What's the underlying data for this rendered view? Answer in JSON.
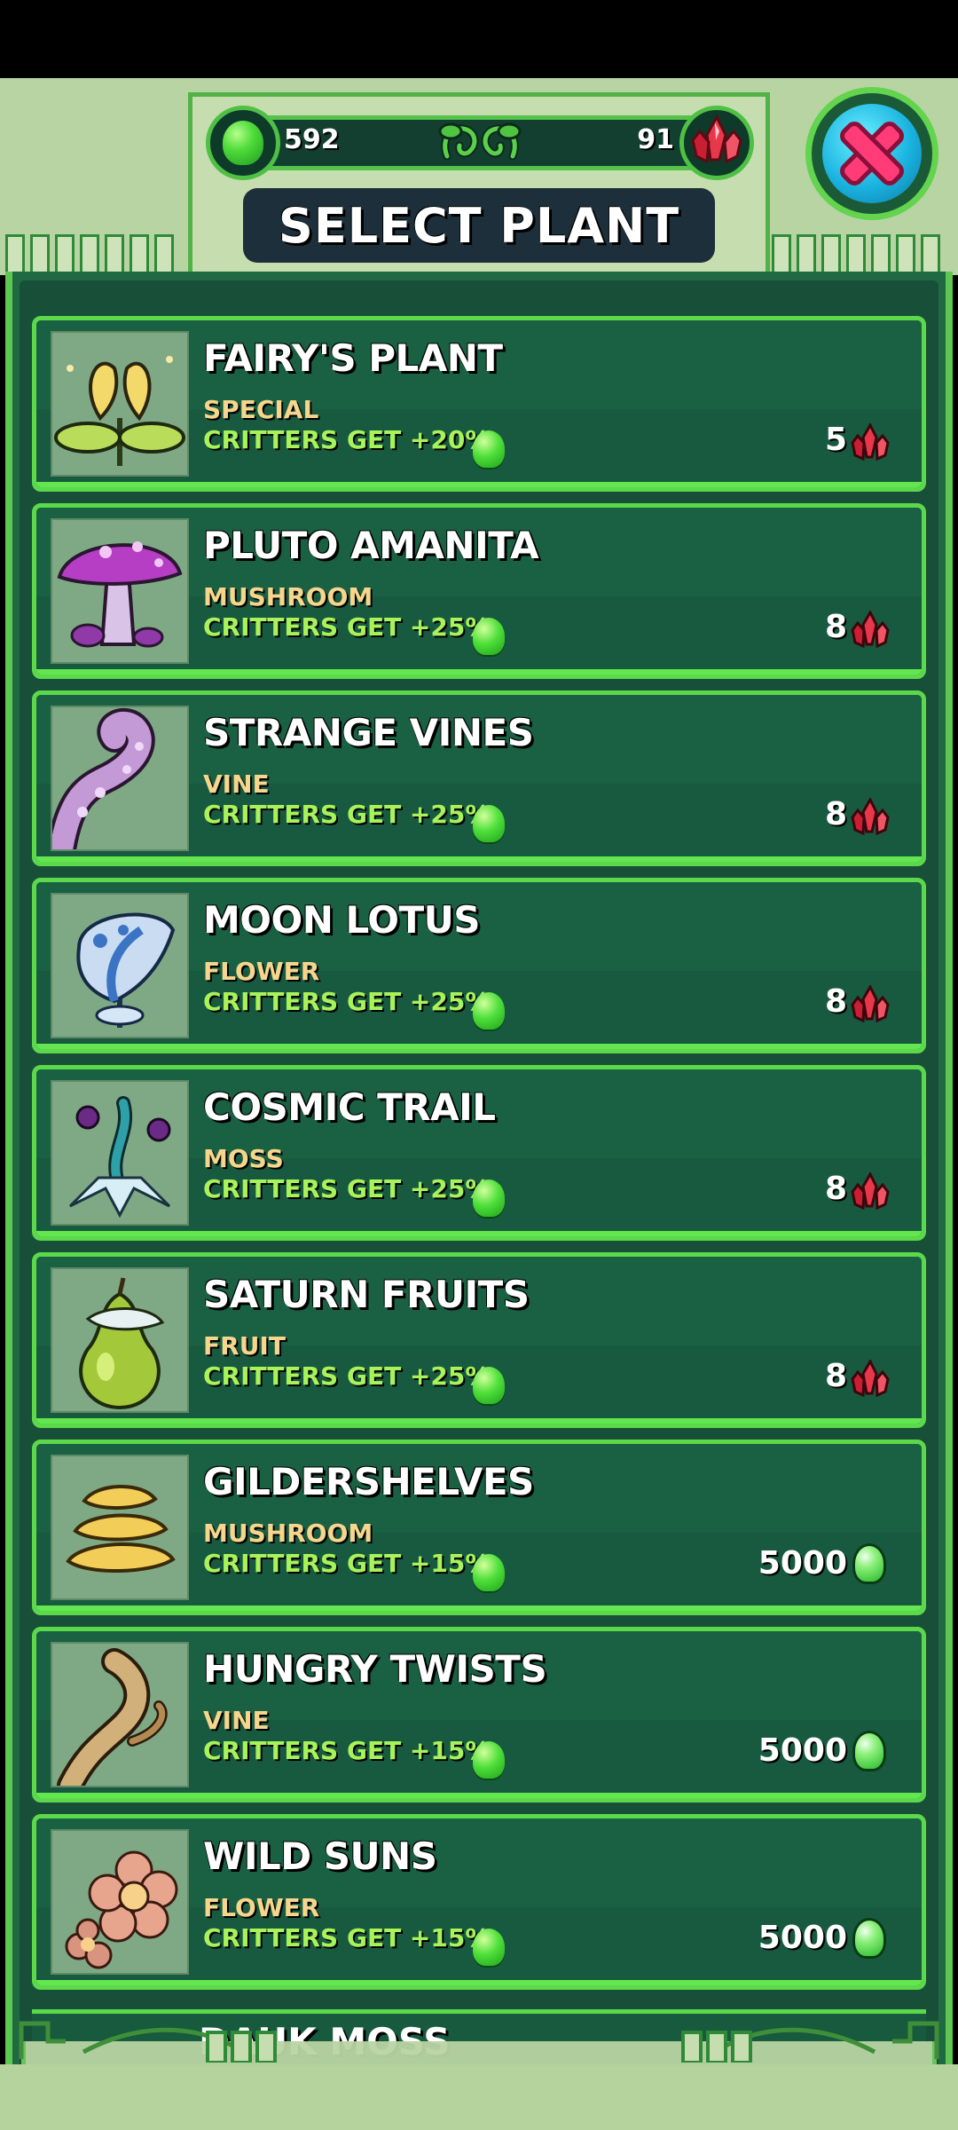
{
  "header": {
    "title": "SELECT PLANT",
    "gel_count": "592",
    "crystal_count": "91",
    "close_icon": "close-x-icon"
  },
  "colors": {
    "accent_green": "#5bd94b",
    "panel_green": "#175a3d",
    "category_gold": "#f6d68c",
    "bonus_lime": "#a8f25a",
    "crystal_red": "#e0283c"
  },
  "plants": [
    {
      "name": "FAIRY'S PLANT",
      "category": "SPECIAL",
      "bonus": "CRITTERS GET +20%",
      "price": "5",
      "currency": "crystal",
      "icon": "fairy-plant-icon"
    },
    {
      "name": "PLUTO AMANITA",
      "category": "MUSHROOM",
      "bonus": "CRITTERS GET +25%",
      "price": "8",
      "currency": "crystal",
      "icon": "purple-mushroom-icon"
    },
    {
      "name": "STRANGE VINES",
      "category": "VINE",
      "bonus": "CRITTERS GET +25%",
      "price": "8",
      "currency": "crystal",
      "icon": "tentacle-vine-icon"
    },
    {
      "name": "MOON LOTUS",
      "category": "FLOWER",
      "bonus": "CRITTERS GET +25%",
      "price": "8",
      "currency": "crystal",
      "icon": "moon-lotus-icon"
    },
    {
      "name": "COSMIC TRAIL",
      "category": "MOSS",
      "bonus": "CRITTERS GET +25%",
      "price": "8",
      "currency": "crystal",
      "icon": "cosmic-trail-icon"
    },
    {
      "name": "SATURN FRUITS",
      "category": "FRUIT",
      "bonus": "CRITTERS GET +25%",
      "price": "8",
      "currency": "crystal",
      "icon": "pear-fruit-icon"
    },
    {
      "name": "GILDERSHELVES",
      "category": "MUSHROOM",
      "bonus": "CRITTERS GET +15%",
      "price": "5000",
      "currency": "gel",
      "icon": "shelf-fungus-icon"
    },
    {
      "name": "HUNGRY TWISTS",
      "category": "VINE",
      "bonus": "CRITTERS GET +15%",
      "price": "5000",
      "currency": "gel",
      "icon": "twisted-vine-icon"
    },
    {
      "name": "WILD SUNS",
      "category": "FLOWER",
      "bonus": "CRITTERS GET +15%",
      "price": "5000",
      "currency": "gel",
      "icon": "pink-flower-icon"
    }
  ],
  "peek_item": {
    "name": "DAUK MOSS"
  }
}
